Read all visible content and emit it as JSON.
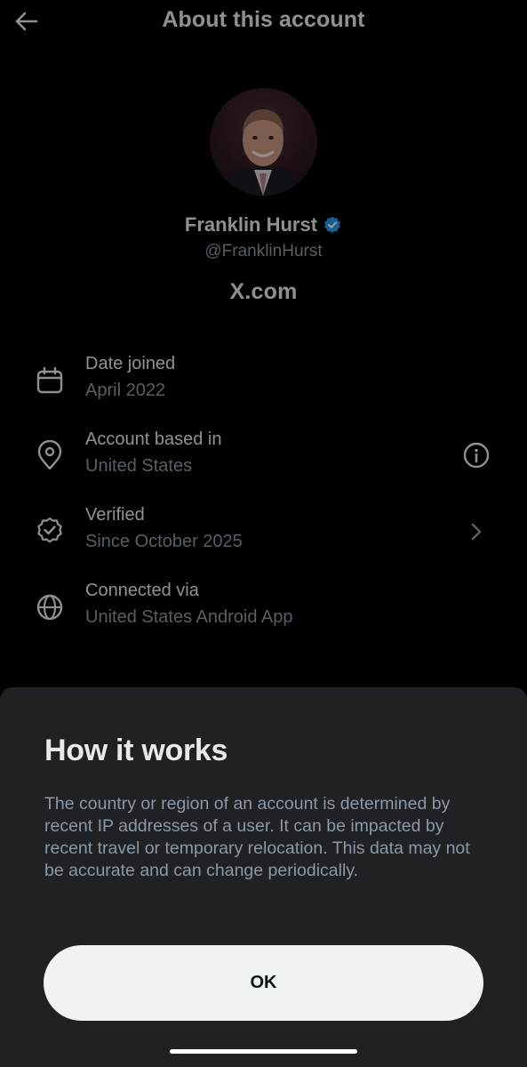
{
  "header": {
    "title": "About this account",
    "back_icon": "arrow-left-icon"
  },
  "profile": {
    "display_name": "Franklin Hurst",
    "handle": "@FranklinHurst",
    "verified_badge_color": "#1d9bf0",
    "site": "X.com"
  },
  "info": {
    "date_joined": {
      "icon": "calendar-icon",
      "title": "Date joined",
      "value": "April 2022"
    },
    "account_based": {
      "icon": "location-pin-icon",
      "title": "Account based in",
      "value": "United States",
      "action_icon": "info-circle-icon"
    },
    "verified": {
      "icon": "verified-check-icon",
      "title": "Verified",
      "value": "Since October 2025",
      "action_icon": "chevron-right-icon"
    },
    "connected": {
      "icon": "globe-icon",
      "title": "Connected via",
      "value": "United States Android App"
    }
  },
  "sheet": {
    "title": "How it works",
    "body": "The country or region of an account is determined by recent IP addresses of a user. It can be impacted by recent travel or temporary relocation. This data may not be accurate and can change periodically.",
    "ok_label": "OK"
  },
  "colors": {
    "background": "#000000",
    "sheet": "#202124",
    "primary_text": "#e7e9ea",
    "secondary_text": "#8b98a5",
    "button": "#eff3f4"
  }
}
